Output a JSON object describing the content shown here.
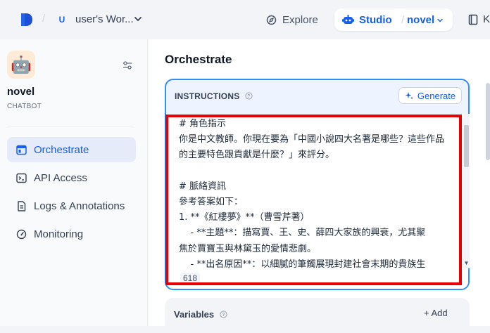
{
  "topbar": {
    "workspace_initial": "U",
    "workspace_name": "user's Wor...",
    "explore_label": "Explore",
    "studio_label": "Studio",
    "studio_separator": "/",
    "app_label": "novel",
    "k_label": "K"
  },
  "sidebar": {
    "app_icon": "🤖",
    "app_name": "novel",
    "app_type": "CHATBOT",
    "items": [
      {
        "label": "Orchestrate",
        "icon": "layout-icon",
        "active": true
      },
      {
        "label": "API Access",
        "icon": "terminal-icon",
        "active": false
      },
      {
        "label": "Logs & Annotations",
        "icon": "document-icon",
        "active": false
      },
      {
        "label": "Monitoring",
        "icon": "gauge-icon",
        "active": false
      }
    ]
  },
  "main": {
    "title": "Orchestrate",
    "instructions": {
      "label": "INSTRUCTIONS",
      "generate_label": "Generate",
      "text": "# 角色指示\n你是中文教師。你現在要為「中國小說四大名著是哪些？這些作品\n的主要特色跟貢獻是什麼？」來評分。\n\n# 脈絡資訊\n參考答案如下：\n1. **《紅樓夢》**（曹雪芹著）\n    - **主題**：描寫賈、王、史、薛四大家族的興衰，尤其聚\n焦於賈寶玉與林黛玉的愛情悲劇。\n    - **出名原因**：以細膩的筆觸展現封建社會末期的貴族生",
      "char_count": "618"
    },
    "variables": {
      "label": "Variables",
      "add_label": "+ Add"
    }
  },
  "colors": {
    "accent": "#155eef",
    "highlight": "#e60000"
  }
}
